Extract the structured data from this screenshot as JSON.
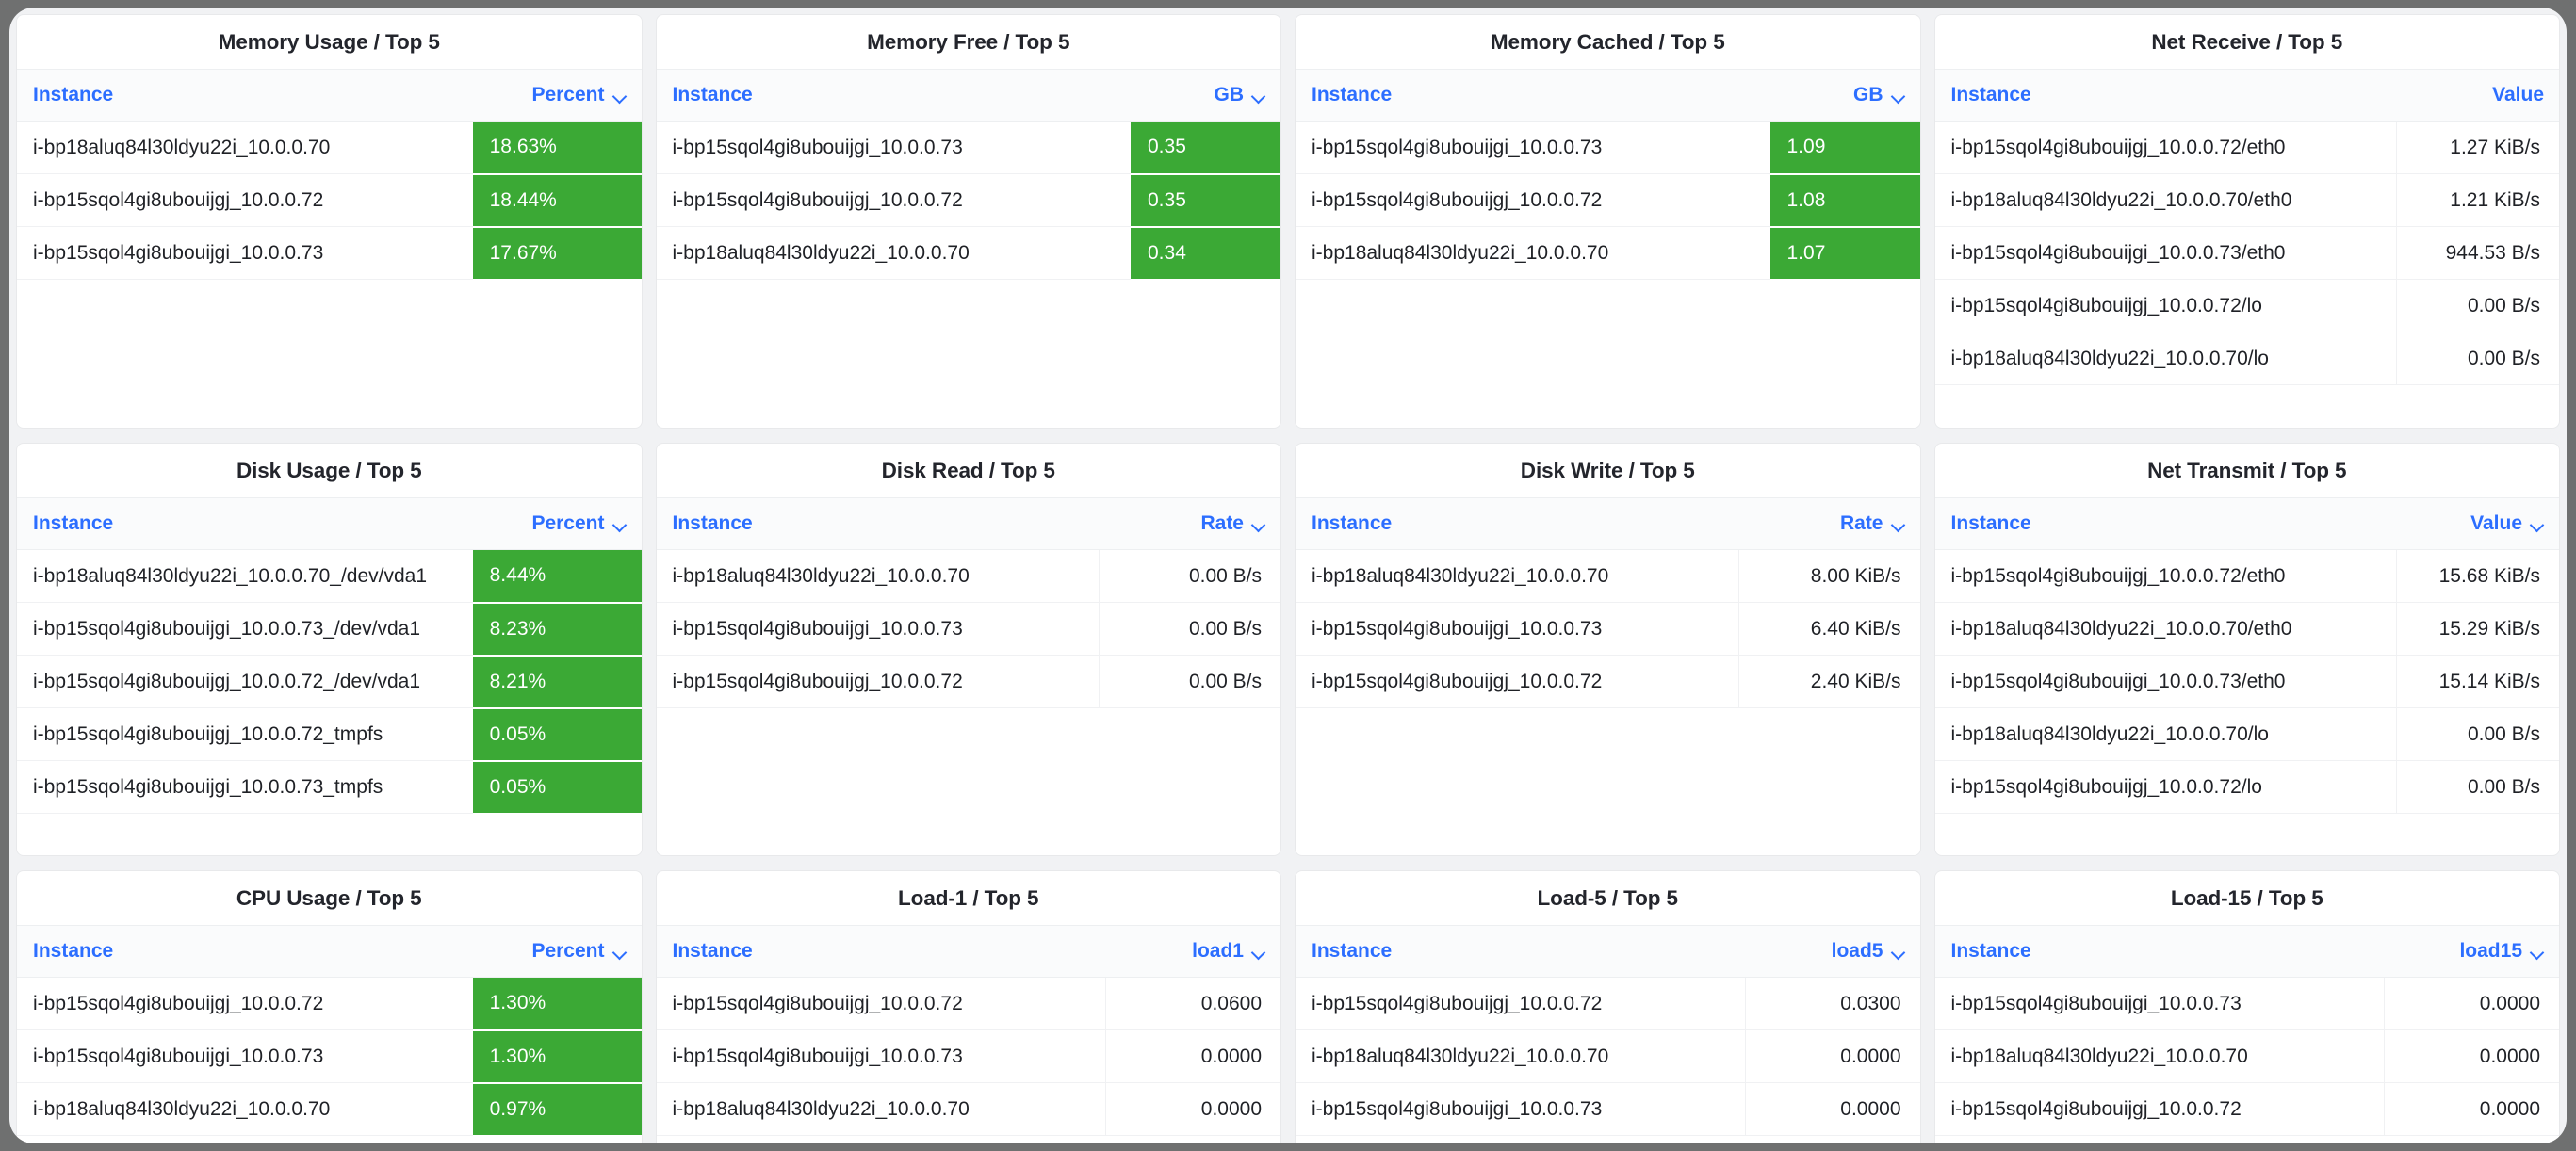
{
  "theme": {
    "accent_blue": "#2c6eff",
    "gauge_green": "#3ba935",
    "panel_bg": "#ffffff",
    "page_bg": "#f1f2f4",
    "title_color": "#23252c"
  },
  "panels": [
    {
      "id": "memory-usage",
      "title": "Memory Usage / Top 5",
      "columns": [
        {
          "label": "Instance",
          "sortable": true,
          "sorted": false
        },
        {
          "label": "Percent",
          "sortable": true,
          "sorted": true
        }
      ],
      "value_style": "filled",
      "rows": [
        {
          "instance": "i-bp18aluq84l30ldyu22i_10.0.0.70",
          "value": "18.63%"
        },
        {
          "instance": "i-bp15sqol4gi8ubouijgj_10.0.0.72",
          "value": "18.44%"
        },
        {
          "instance": "i-bp15sqol4gi8ubouijgi_10.0.0.73",
          "value": "17.67%"
        }
      ]
    },
    {
      "id": "memory-free",
      "title": "Memory Free / Top 5",
      "columns": [
        {
          "label": "Instance",
          "sortable": true,
          "sorted": false
        },
        {
          "label": "GB",
          "sortable": true,
          "sorted": true
        }
      ],
      "value_style": "filled",
      "rows": [
        {
          "instance": "i-bp15sqol4gi8ubouijgi_10.0.0.73",
          "value": "0.35"
        },
        {
          "instance": "i-bp15sqol4gi8ubouijgj_10.0.0.72",
          "value": "0.35"
        },
        {
          "instance": "i-bp18aluq84l30ldyu22i_10.0.0.70",
          "value": "0.34"
        }
      ]
    },
    {
      "id": "memory-cached",
      "title": "Memory Cached / Top 5",
      "columns": [
        {
          "label": "Instance",
          "sortable": true,
          "sorted": false
        },
        {
          "label": "GB",
          "sortable": true,
          "sorted": true
        }
      ],
      "value_style": "filled",
      "rows": [
        {
          "instance": "i-bp15sqol4gi8ubouijgi_10.0.0.73",
          "value": "1.09"
        },
        {
          "instance": "i-bp15sqol4gi8ubouijgj_10.0.0.72",
          "value": "1.08"
        },
        {
          "instance": "i-bp18aluq84l30ldyu22i_10.0.0.70",
          "value": "1.07"
        }
      ]
    },
    {
      "id": "net-receive",
      "title": "Net Receive / Top 5",
      "columns": [
        {
          "label": "Instance",
          "sortable": true,
          "sorted": false
        },
        {
          "label": "Value",
          "sortable": true,
          "sorted": false
        }
      ],
      "value_style": "plain",
      "rows": [
        {
          "instance": "i-bp15sqol4gi8ubouijgj_10.0.0.72/eth0",
          "value": "1.27 KiB/s"
        },
        {
          "instance": "i-bp18aluq84l30ldyu22i_10.0.0.70/eth0",
          "value": "1.21 KiB/s"
        },
        {
          "instance": "i-bp15sqol4gi8ubouijgi_10.0.0.73/eth0",
          "value": "944.53 B/s"
        },
        {
          "instance": "i-bp15sqol4gi8ubouijgj_10.0.0.72/lo",
          "value": "0.00 B/s"
        },
        {
          "instance": "i-bp18aluq84l30ldyu22i_10.0.0.70/lo",
          "value": "0.00 B/s"
        }
      ]
    },
    {
      "id": "disk-usage",
      "title": "Disk Usage / Top 5",
      "columns": [
        {
          "label": "Instance",
          "sortable": true,
          "sorted": false
        },
        {
          "label": "Percent",
          "sortable": true,
          "sorted": true
        }
      ],
      "value_style": "filled",
      "rows": [
        {
          "instance": "i-bp18aluq84l30ldyu22i_10.0.0.70_/dev/vda1",
          "value": "8.44%"
        },
        {
          "instance": "i-bp15sqol4gi8ubouijgi_10.0.0.73_/dev/vda1",
          "value": "8.23%"
        },
        {
          "instance": "i-bp15sqol4gi8ubouijgj_10.0.0.72_/dev/vda1",
          "value": "8.21%"
        },
        {
          "instance": "i-bp15sqol4gi8ubouijgj_10.0.0.72_tmpfs",
          "value": "0.05%"
        },
        {
          "instance": "i-bp15sqol4gi8ubouijgi_10.0.0.73_tmpfs",
          "value": "0.05%"
        }
      ]
    },
    {
      "id": "disk-read",
      "title": "Disk Read / Top 5",
      "columns": [
        {
          "label": "Instance",
          "sortable": true,
          "sorted": false
        },
        {
          "label": "Rate",
          "sortable": true,
          "sorted": true
        }
      ],
      "value_style": "plain",
      "rows": [
        {
          "instance": "i-bp18aluq84l30ldyu22i_10.0.0.70",
          "value": "0.00 B/s"
        },
        {
          "instance": "i-bp15sqol4gi8ubouijgi_10.0.0.73",
          "value": "0.00 B/s"
        },
        {
          "instance": "i-bp15sqol4gi8ubouijgj_10.0.0.72",
          "value": "0.00 B/s"
        }
      ]
    },
    {
      "id": "disk-write",
      "title": "Disk Write / Top 5",
      "columns": [
        {
          "label": "Instance",
          "sortable": true,
          "sorted": false
        },
        {
          "label": "Rate",
          "sortable": true,
          "sorted": true
        }
      ],
      "value_style": "plain",
      "rows": [
        {
          "instance": "i-bp18aluq84l30ldyu22i_10.0.0.70",
          "value": "8.00 KiB/s"
        },
        {
          "instance": "i-bp15sqol4gi8ubouijgi_10.0.0.73",
          "value": "6.40 KiB/s"
        },
        {
          "instance": "i-bp15sqol4gi8ubouijgj_10.0.0.72",
          "value": "2.40 KiB/s"
        }
      ]
    },
    {
      "id": "net-transmit",
      "title": "Net Transmit / Top 5",
      "columns": [
        {
          "label": "Instance",
          "sortable": true,
          "sorted": false
        },
        {
          "label": "Value",
          "sortable": true,
          "sorted": true
        }
      ],
      "value_style": "plain",
      "rows": [
        {
          "instance": "i-bp15sqol4gi8ubouijgj_10.0.0.72/eth0",
          "value": "15.68 KiB/s"
        },
        {
          "instance": "i-bp18aluq84l30ldyu22i_10.0.0.70/eth0",
          "value": "15.29 KiB/s"
        },
        {
          "instance": "i-bp15sqol4gi8ubouijgi_10.0.0.73/eth0",
          "value": "15.14 KiB/s"
        },
        {
          "instance": "i-bp18aluq84l30ldyu22i_10.0.0.70/lo",
          "value": "0.00 B/s"
        },
        {
          "instance": "i-bp15sqol4gi8ubouijgj_10.0.0.72/lo",
          "value": "0.00 B/s"
        }
      ]
    },
    {
      "id": "cpu-usage",
      "title": "CPU Usage / Top 5",
      "columns": [
        {
          "label": "Instance",
          "sortable": true,
          "sorted": false
        },
        {
          "label": "Percent",
          "sortable": true,
          "sorted": true
        }
      ],
      "value_style": "filled",
      "rows": [
        {
          "instance": "i-bp15sqol4gi8ubouijgj_10.0.0.72",
          "value": "1.30%"
        },
        {
          "instance": "i-bp15sqol4gi8ubouijgi_10.0.0.73",
          "value": "1.30%"
        },
        {
          "instance": "i-bp18aluq84l30ldyu22i_10.0.0.70",
          "value": "0.97%"
        }
      ]
    },
    {
      "id": "load-1",
      "title": "Load-1 / Top 5",
      "columns": [
        {
          "label": "Instance",
          "sortable": true,
          "sorted": false
        },
        {
          "label": "load1",
          "sortable": true,
          "sorted": true
        }
      ],
      "value_style": "plain",
      "rows": [
        {
          "instance": "i-bp15sqol4gi8ubouijgj_10.0.0.72",
          "value": "0.0600"
        },
        {
          "instance": "i-bp15sqol4gi8ubouijgi_10.0.0.73",
          "value": "0.0000"
        },
        {
          "instance": "i-bp18aluq84l30ldyu22i_10.0.0.70",
          "value": "0.0000"
        }
      ]
    },
    {
      "id": "load-5",
      "title": "Load-5 / Top 5",
      "columns": [
        {
          "label": "Instance",
          "sortable": true,
          "sorted": false
        },
        {
          "label": "load5",
          "sortable": true,
          "sorted": true
        }
      ],
      "value_style": "plain",
      "rows": [
        {
          "instance": "i-bp15sqol4gi8ubouijgj_10.0.0.72",
          "value": "0.0300"
        },
        {
          "instance": "i-bp18aluq84l30ldyu22i_10.0.0.70",
          "value": "0.0000"
        },
        {
          "instance": "i-bp15sqol4gi8ubouijgi_10.0.0.73",
          "value": "0.0000"
        }
      ]
    },
    {
      "id": "load-15",
      "title": "Load-15 / Top 5",
      "columns": [
        {
          "label": "Instance",
          "sortable": true,
          "sorted": false
        },
        {
          "label": "load15",
          "sortable": true,
          "sorted": true
        }
      ],
      "value_style": "plain",
      "rows": [
        {
          "instance": "i-bp15sqol4gi8ubouijgi_10.0.0.73",
          "value": "0.0000"
        },
        {
          "instance": "i-bp18aluq84l30ldyu22i_10.0.0.70",
          "value": "0.0000"
        },
        {
          "instance": "i-bp15sqol4gi8ubouijgj_10.0.0.72",
          "value": "0.0000"
        }
      ]
    }
  ],
  "layout": {
    "rows": [
      [
        "memory-usage",
        "memory-free",
        "memory-cached",
        "net-receive"
      ],
      [
        "disk-usage",
        "disk-read",
        "disk-write",
        "net-transmit"
      ],
      [
        "cpu-usage",
        "load-1",
        "load-5",
        "load-15"
      ]
    ]
  }
}
